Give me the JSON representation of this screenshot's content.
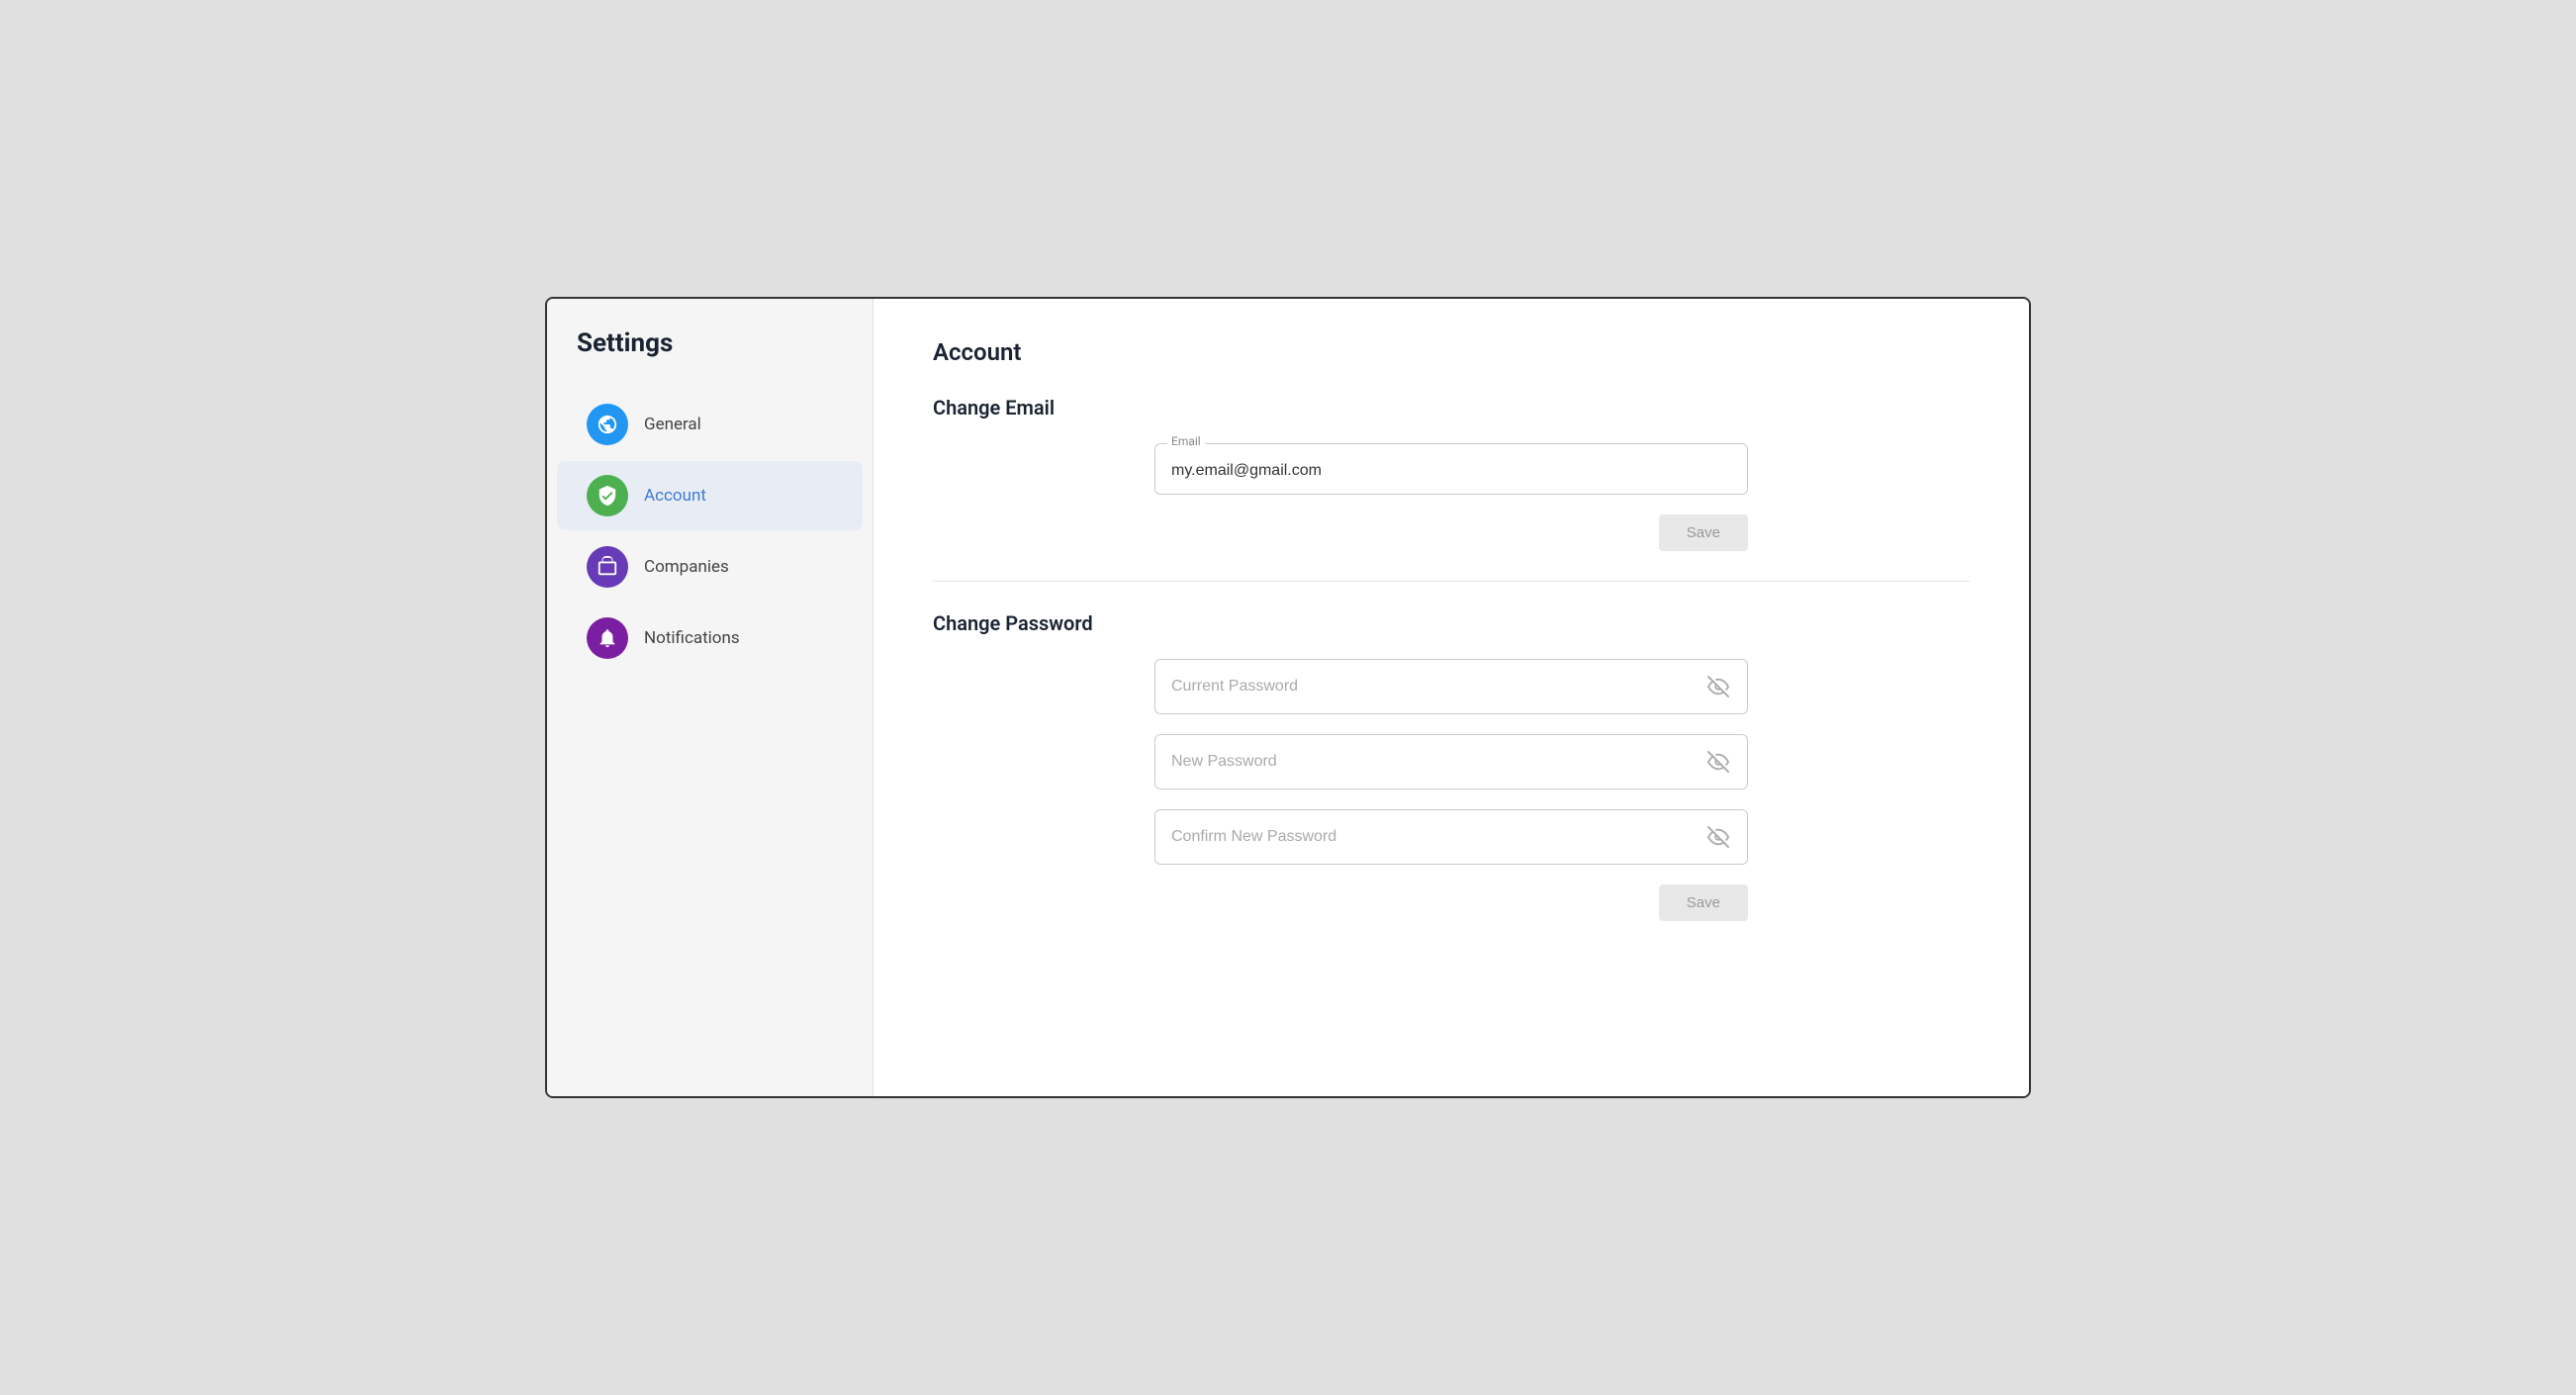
{
  "app": {
    "title": "Settings"
  },
  "sidebar": {
    "items": [
      {
        "id": "general",
        "label": "General",
        "icon": "globe-icon",
        "iconClass": "icon-general",
        "active": false
      },
      {
        "id": "account",
        "label": "Account",
        "icon": "shield-icon",
        "iconClass": "icon-account",
        "active": true
      },
      {
        "id": "companies",
        "label": "Companies",
        "icon": "briefcase-icon",
        "iconClass": "icon-companies",
        "active": false
      },
      {
        "id": "notifications",
        "label": "Notifications",
        "icon": "bell-icon",
        "iconClass": "icon-notifications",
        "active": false
      }
    ]
  },
  "main": {
    "page_title": "Account",
    "change_email": {
      "section_title": "Change Email",
      "email_label": "Email",
      "email_value": "my.email@gmail.com",
      "save_label": "Save"
    },
    "change_password": {
      "section_title": "Change Password",
      "current_password_placeholder": "Current Password",
      "new_password_placeholder": "New Password",
      "confirm_password_placeholder": "Confirm New Password",
      "save_label": "Save"
    }
  }
}
